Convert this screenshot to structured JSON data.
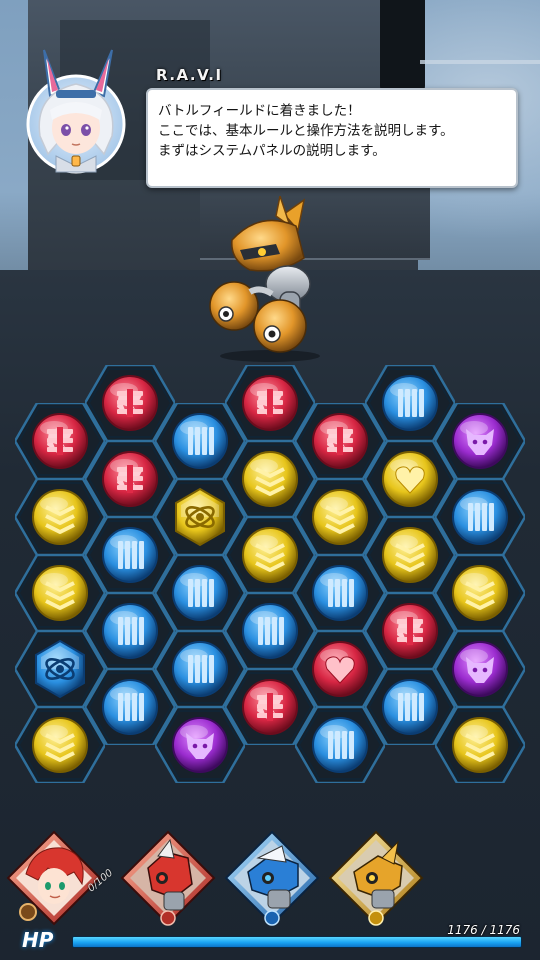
{
  "dialogue": {
    "speaker": "R.A.V.I",
    "lines": [
      "バトルフィールドに着きました！",
      "ここでは、基本ルールと操作方法を説明します。",
      "まずはシステムパネルの説明します。"
    ]
  },
  "colors": {
    "red": "#d72643",
    "blue": "#2a8fe0",
    "yellow": "#e7c51b",
    "purple": "#9b2ccf",
    "hp": "#1aa3f2"
  },
  "board": {
    "rows": [
      [
        null,
        "red-bolt-icon",
        null,
        "red-bolt-icon",
        null,
        "blue-bars-icon",
        null
      ],
      [
        "red-bolt-icon",
        null,
        "blue-bars-icon",
        null,
        "red-bolt-icon",
        null,
        "purple-beast-icon"
      ],
      [
        null,
        "red-bolt-icon",
        null,
        "yellow-chevrons-icon",
        null,
        "yellow-heart-icon",
        null
      ],
      [
        "yellow-chevrons-icon",
        null,
        "yellow-atom-icon",
        null,
        "yellow-chevrons-icon",
        null,
        "blue-bars-icon"
      ],
      [
        null,
        "blue-bars-icon",
        null,
        "yellow-chevrons-icon",
        null,
        "yellow-chevrons-icon",
        null
      ],
      [
        "yellow-chevrons-icon",
        null,
        "blue-bars-icon",
        null,
        "blue-bars-icon",
        null,
        "yellow-chevrons-icon"
      ],
      [
        null,
        "blue-bars-icon",
        null,
        "blue-bars-icon",
        null,
        "red-bolt-icon",
        null
      ],
      [
        "blue-atom-icon",
        null,
        "blue-bars-icon",
        null,
        "red-heart-icon",
        null,
        "purple-beast-icon"
      ],
      [
        null,
        "blue-bars-icon",
        null,
        "red-bolt-icon",
        null,
        "blue-bars-icon",
        null
      ],
      [
        "yellow-chevrons-icon",
        null,
        "purple-beast-icon",
        null,
        "blue-bars-icon",
        null,
        "yellow-chevrons-icon"
      ]
    ]
  },
  "party": {
    "members": [
      {
        "name": "leader-portrait",
        "frame": "red"
      },
      {
        "name": "red-robot-portrait",
        "frame": "red"
      },
      {
        "name": "blue-robot-portrait",
        "frame": "blue"
      },
      {
        "name": "gold-robot-portrait",
        "frame": "yellow"
      }
    ],
    "leader_count": "0/100"
  },
  "hp": {
    "label": "HP",
    "value_text": "1176 / 1176",
    "current": 1176,
    "max": 1176
  }
}
